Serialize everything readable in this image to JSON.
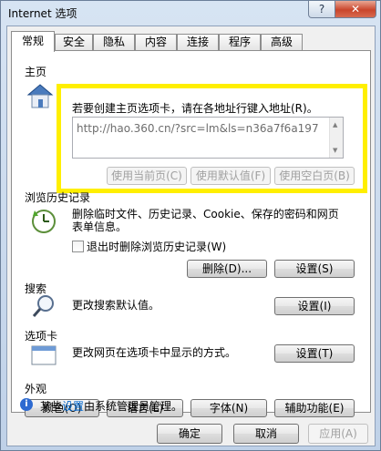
{
  "window": {
    "title": "Internet 选项"
  },
  "tabs": [
    "常规",
    "安全",
    "隐私",
    "内容",
    "连接",
    "程序",
    "高级"
  ],
  "homepage": {
    "label": "主页",
    "hint": "若要创建主页选项卡，请在各地址行键入地址(R)。",
    "url": "http://hao.360.cn/?src=lm&ls=n36a7f6a197",
    "btn_current": "使用当前页(C)",
    "btn_default": "使用默认值(F)",
    "btn_blank": "使用空白页(B)"
  },
  "history": {
    "label": "浏览历史记录",
    "desc_line1": "删除临时文件、历史记录、Cookie、保存的密码和网页",
    "desc_line2": "表单信息。",
    "checkbox": "退出时删除浏览历史记录(W)",
    "btn_delete": "删除(D)...",
    "btn_settings": "设置(S)"
  },
  "search": {
    "label": "搜索",
    "desc": "更改搜索默认值。",
    "btn_settings": "设置(I)"
  },
  "tabs_section": {
    "label": "选项卡",
    "desc": "更改网页在选项卡中显示的方式。",
    "btn_settings": "设置(T)"
  },
  "appearance": {
    "label": "外观",
    "btn_colors": "颜色(O)",
    "btn_languages": "语言(L)",
    "btn_fonts": "字体(N)",
    "btn_accessibility": "辅助功能(E)"
  },
  "info": {
    "prefix": "某些",
    "link": "设置",
    "suffix": "由系统管理员管理。"
  },
  "footer": {
    "ok": "确定",
    "cancel": "取消",
    "apply": "应用(A)"
  },
  "colors": {
    "highlight": "#ffef00",
    "link": "#0066cc"
  }
}
